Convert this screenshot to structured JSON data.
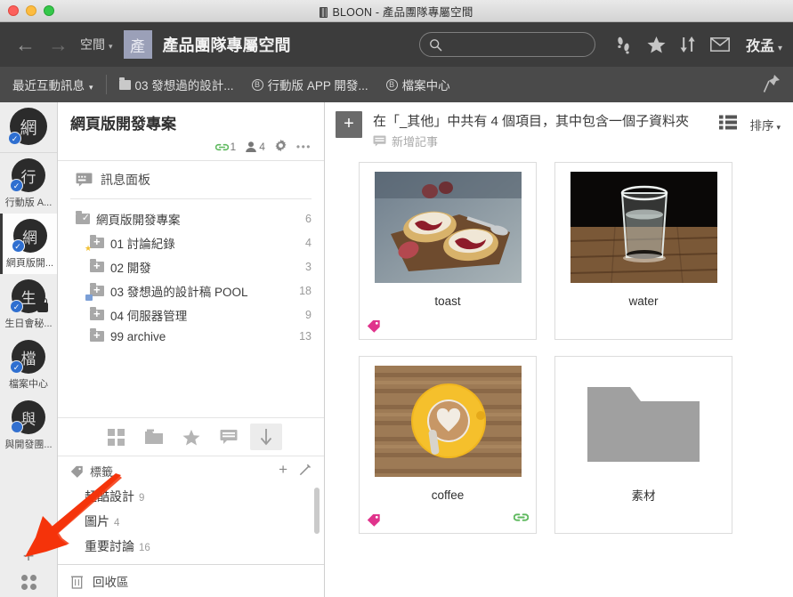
{
  "window": {
    "title": "BLOON - 產品團隊專屬空間",
    "app_icon": "app-icon",
    "controls": [
      "close",
      "minimize",
      "zoom"
    ]
  },
  "toolbar": {
    "back_icon": "←",
    "forward_icon": "→",
    "space_menu_label": "空間",
    "caret": "⌄",
    "space_badge": "產",
    "space_title": "產品團隊專屬空間",
    "search_placeholder": "",
    "search_value": "",
    "icons": [
      "footprints-icon",
      "star-icon",
      "sort-icon",
      "mail-icon"
    ],
    "user_name": "孜孟"
  },
  "tabbar": {
    "recent_label": "最近互動訊息",
    "tabs": [
      {
        "label": "03 發想過的設計...",
        "icon": "folder-icon"
      },
      {
        "label": "行動版 APP 開發...",
        "icon": "b-circle-icon"
      },
      {
        "label": "檔案中心",
        "icon": "b-circle-icon"
      }
    ],
    "pin_icon": "pin-icon"
  },
  "rail": {
    "current": {
      "initial": "網",
      "badge": "check"
    },
    "items": [
      {
        "initial": "行",
        "label": "行動版 A...",
        "badge": "check",
        "locked": false,
        "active": false
      },
      {
        "initial": "網",
        "label": "網頁版開...",
        "badge": "check",
        "locked": false,
        "active": true
      },
      {
        "initial": "生",
        "label": "生日會秘...",
        "badge": "check",
        "locked": true,
        "active": false
      },
      {
        "initial": "檔",
        "label": "檔案中心",
        "badge": "check",
        "locked": false,
        "active": false
      },
      {
        "initial": "與",
        "label": "與開發團...",
        "badge": "dot",
        "locked": false,
        "active": false
      }
    ],
    "add_label": "+",
    "grid_icon": "apps-grid-icon"
  },
  "panel": {
    "title": "網頁版開發專案",
    "meta": {
      "link_icon": "link-icon",
      "link_count": "1",
      "people_icon": "people-icon",
      "people_count": "4",
      "gear_icon": "gear-icon",
      "more_icon": "more-icon"
    },
    "message_board": {
      "label": "訊息面板",
      "icon": "message-board-icon"
    },
    "tree": [
      {
        "label": "網頁版開發專案",
        "count": "6",
        "level": 0,
        "icon": "folder-check-icon",
        "badge": ""
      },
      {
        "label": "01 討論紀錄",
        "count": "4",
        "level": 1,
        "icon": "folder-plus-icon",
        "badge": "star"
      },
      {
        "label": "02 開發",
        "count": "3",
        "level": 1,
        "icon": "folder-plus-icon",
        "badge": ""
      },
      {
        "label": "03 發想過的設計稿 POOL",
        "count": "18",
        "level": 1,
        "icon": "folder-plus-icon",
        "badge": "blue"
      },
      {
        "label": "04 伺服器管理",
        "count": "9",
        "level": 1,
        "icon": "folder-plus-icon",
        "badge": ""
      },
      {
        "label": "99 archive",
        "count": "13",
        "level": 1,
        "icon": "folder-plus-icon",
        "badge": ""
      }
    ],
    "view_buttons": [
      {
        "name": "grid-view-icon",
        "selected": false
      },
      {
        "name": "folder-view-icon",
        "selected": false
      },
      {
        "name": "star-view-icon",
        "selected": false
      },
      {
        "name": "comment-view-icon",
        "selected": false
      },
      {
        "name": "download-view-icon",
        "selected": true
      }
    ],
    "tags_header": {
      "label": "標籤",
      "tag_icon": "tag-icon",
      "add_icon": "+",
      "edit_icon": "pencil-icon"
    },
    "tags": [
      {
        "label": "超酷設計",
        "count": "9"
      },
      {
        "label": "圖片",
        "count": "4"
      },
      {
        "label": "重要討論",
        "count": "16"
      }
    ],
    "trash": {
      "label": "回收區",
      "icon": "trash-icon"
    }
  },
  "main": {
    "add_button": "+",
    "heading": "在「_其他」中共有 4 個項目，其中包含一個子資料夾",
    "add_note": {
      "label": "新增記事",
      "icon": "note-icon"
    },
    "list_view_icon": "list-view-icon",
    "sort_label": "排序",
    "cards": [
      {
        "label": "toast",
        "type": "image",
        "image": "toast-thumbnail",
        "has_tag": true,
        "has_link": false
      },
      {
        "label": "water",
        "type": "image",
        "image": "water-thumbnail",
        "has_tag": false,
        "has_link": false
      },
      {
        "label": "coffee",
        "type": "image",
        "image": "coffee-thumbnail",
        "has_tag": true,
        "has_link": true
      },
      {
        "label": "素材",
        "type": "folder",
        "image": "folder-thumbnail",
        "has_tag": false,
        "has_link": false
      }
    ]
  },
  "annotation": {
    "type": "arrow",
    "color": "#f5340b",
    "points_to": "tag-list"
  },
  "colors": {
    "toolbar_bg": "#3c3c3c",
    "tabbar_bg": "#4a4a4a",
    "space_badge_bg": "#9ba0b8",
    "accent_blue": "#2f6fd0",
    "tag_pink": "#e0338c",
    "link_green": "#5cb85c",
    "annotation_red": "#f5340b"
  }
}
